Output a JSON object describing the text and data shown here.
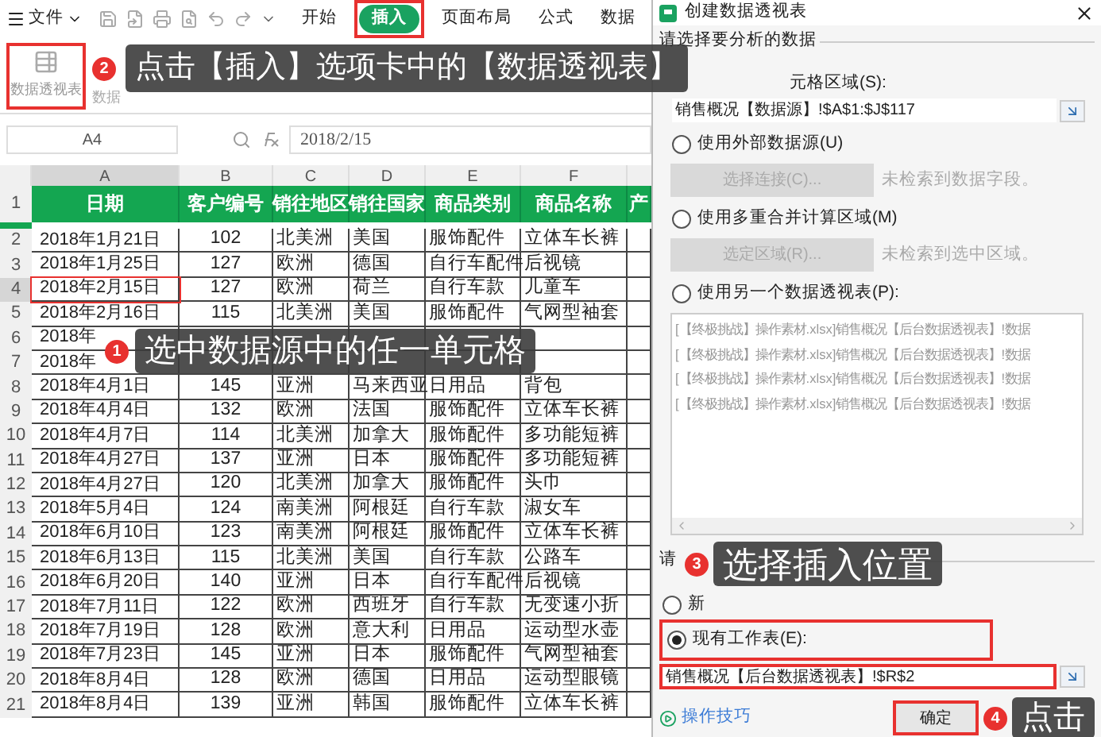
{
  "app_bar": {
    "menu": "文件",
    "tabs": [
      {
        "label": "开始",
        "selected": false
      },
      {
        "label": "插入",
        "selected": true
      },
      {
        "label": "页面布局",
        "selected": false
      },
      {
        "label": "公式",
        "selected": false
      },
      {
        "label": "数据",
        "selected": false
      }
    ]
  },
  "toolbar": {
    "button": "数据透视表",
    "visible_fragment": "数据",
    "callout": {
      "badge": "2",
      "text": "点击【插入】选项卡中的【数据透视表】"
    }
  },
  "formula_bar": {
    "name_box": "A4",
    "formula": "2018/2/15"
  },
  "sheet": {
    "columns": [
      {
        "label": "A",
        "selected": true
      },
      {
        "label": "B",
        "selected": false
      },
      {
        "label": "C",
        "selected": false
      },
      {
        "label": "D",
        "selected": false
      },
      {
        "label": "E",
        "selected": false
      },
      {
        "label": "F",
        "selected": false
      }
    ],
    "header_row": {
      "number": "1",
      "cells": [
        "日期",
        "客户编号",
        "销往地区",
        "销往国家",
        "商品类别",
        "商品名称",
        "产"
      ]
    },
    "rows": [
      {
        "number": "2",
        "selected": false,
        "cells": [
          "2018年1月21日",
          "102",
          "北美洲",
          "美国",
          "服饰配件",
          "立体车长裤"
        ]
      },
      {
        "number": "3",
        "selected": false,
        "cells": [
          "2018年1月25日",
          "127",
          "欧洲",
          "德国",
          "自行车配件",
          "后视镜"
        ]
      },
      {
        "number": "4",
        "selected": true,
        "cells": [
          "2018年2月15日",
          "127",
          "欧洲",
          "荷兰",
          "自行车款",
          "儿童车"
        ]
      },
      {
        "number": "5",
        "selected": false,
        "cells": [
          "2018年2月16日",
          "115",
          "北美洲",
          "美国",
          "服饰配件",
          "气网型袖套"
        ]
      },
      {
        "number": "6",
        "selected": false,
        "cells": [
          "2018年"
        ]
      },
      {
        "number": "7",
        "selected": false,
        "cells": [
          "2018年"
        ]
      },
      {
        "number": "8",
        "selected": false,
        "cells": [
          "2018年4月1日",
          "145",
          "亚洲",
          "马来西亚",
          "日用品",
          "背包"
        ]
      },
      {
        "number": "9",
        "selected": false,
        "cells": [
          "2018年4月4日",
          "132",
          "欧洲",
          "法国",
          "服饰配件",
          "立体车长裤"
        ]
      },
      {
        "number": "10",
        "selected": false,
        "cells": [
          "2018年4月7日",
          "114",
          "北美洲",
          "加拿大",
          "服饰配件",
          "多功能短裤"
        ]
      },
      {
        "number": "11",
        "selected": false,
        "cells": [
          "2018年4月27日",
          "137",
          "亚洲",
          "日本",
          "服饰配件",
          "多功能短裤"
        ]
      },
      {
        "number": "12",
        "selected": false,
        "cells": [
          "2018年4月27日",
          "120",
          "北美洲",
          "加拿大",
          "服饰配件",
          "头巾"
        ]
      },
      {
        "number": "13",
        "selected": false,
        "cells": [
          "2018年5月4日",
          "124",
          "南美洲",
          "阿根廷",
          "自行车款",
          "淑女车"
        ]
      },
      {
        "number": "14",
        "selected": false,
        "cells": [
          "2018年6月10日",
          "123",
          "南美洲",
          "阿根廷",
          "服饰配件",
          "立体车长裤"
        ]
      },
      {
        "number": "15",
        "selected": false,
        "cells": [
          "2018年6月13日",
          "115",
          "北美洲",
          "美国",
          "自行车款",
          "公路车"
        ]
      },
      {
        "number": "16",
        "selected": false,
        "cells": [
          "2018年6月20日",
          "140",
          "亚洲",
          "日本",
          "自行车配件",
          "后视镜"
        ]
      },
      {
        "number": "17",
        "selected": false,
        "cells": [
          "2018年7月11日",
          "122",
          "欧洲",
          "西班牙",
          "自行车款",
          "无变速小折"
        ]
      },
      {
        "number": "18",
        "selected": false,
        "cells": [
          "2018年7月19日",
          "128",
          "欧洲",
          "意大利",
          "日用品",
          "运动型水壶"
        ]
      },
      {
        "number": "19",
        "selected": false,
        "cells": [
          "2018年7月23日",
          "145",
          "亚洲",
          "日本",
          "服饰配件",
          "气网型袖套"
        ]
      },
      {
        "number": "20",
        "selected": false,
        "cells": [
          "2018年8月4日",
          "128",
          "欧洲",
          "德国",
          "日用品",
          "运动型眼镜"
        ]
      },
      {
        "number": "21",
        "selected": false,
        "cells": [
          "2018年8月4日",
          "139",
          "亚洲",
          "韩国",
          "服饰配件",
          "立体车长裤"
        ]
      }
    ],
    "callout": {
      "badge": "1",
      "text": "选中数据源中的任一单元格"
    }
  },
  "dialog": {
    "title": "创建数据透视表",
    "source_section": {
      "label": "请选择要分析的数据",
      "range_label": "元格区域(S):",
      "range_value": "销售概况【数据源】!$A$1:$J$117",
      "options": [
        {
          "label": "使用外部数据源(U)",
          "selected": false,
          "button": "选择连接(C)...",
          "hint": "未检索到数据字段。"
        },
        {
          "label": "使用多重合并计算区域(M)",
          "selected": false,
          "button": "选定区域(R)...",
          "hint": "未检索到选中区域。"
        },
        {
          "label": "使用另一个数据透视表(P):",
          "selected": false
        }
      ],
      "pivot_list": [
        "[【终极挑战】操作素材.xlsx]销售概况【后台数据透视表】!数据",
        "[【终极挑战】操作素材.xlsx]销售概况【后台数据透视表】!数据",
        "[【终极挑战】操作素材.xlsx]销售概况【后台数据透视表】!数据",
        "[【终极挑战】操作素材.xlsx]销售概况【后台数据透视表】!数据"
      ]
    },
    "placement_section": {
      "label": "请",
      "options": [
        {
          "label": "新",
          "selected": false
        },
        {
          "label": "现有工作表(E):",
          "selected": true
        }
      ],
      "location_value": "销售概况【后台数据透视表】!$R$2",
      "callout": {
        "badge": "3",
        "text": "选择插入位置"
      }
    },
    "tips_link": "操作技巧",
    "ok_button": "确定",
    "callout": {
      "badge": "4",
      "text": "点击"
    }
  }
}
